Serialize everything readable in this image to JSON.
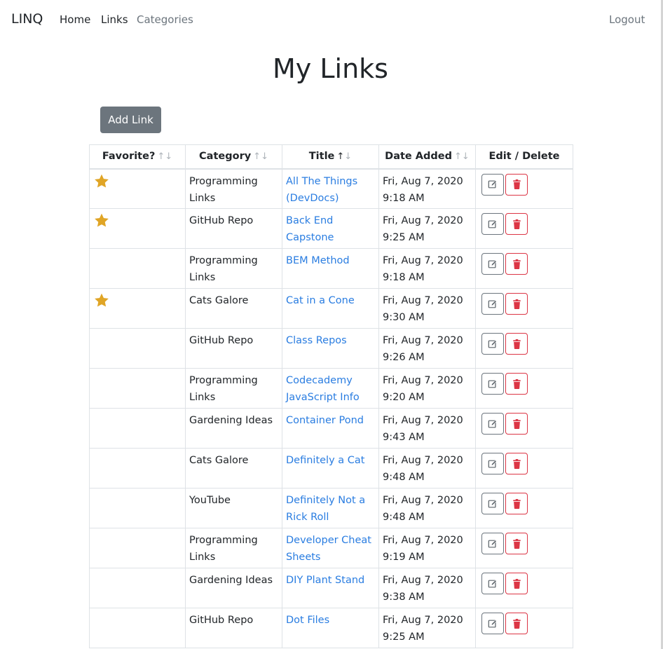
{
  "nav": {
    "brand": "LINQ",
    "home": "Home",
    "links": "Links",
    "categories": "Categories",
    "logout": "Logout"
  },
  "page": {
    "title": "My Links",
    "add_button": "Add Link"
  },
  "table": {
    "columns": [
      {
        "label": "Favorite?",
        "sort_icon": "↑↓"
      },
      {
        "label": "Category",
        "sort_icon": "↑↓"
      },
      {
        "label": "Title",
        "sort_icon_up": "↑",
        "sort_icon_down": "↓"
      },
      {
        "label": "Date Added",
        "sort_icon": "↑↓"
      },
      {
        "label": "Edit / Delete"
      }
    ],
    "rows": [
      {
        "favorite": true,
        "category": "Programming Links",
        "title": "All The Things (DevDocs)",
        "date": "Fri, Aug 7, 2020",
        "time": "9:18 AM"
      },
      {
        "favorite": true,
        "category": "GitHub Repo",
        "title": "Back End Capstone",
        "date": "Fri, Aug 7, 2020",
        "time": "9:25 AM"
      },
      {
        "favorite": false,
        "category": "Programming Links",
        "title": "BEM Method",
        "date": "Fri, Aug 7, 2020",
        "time": "9:18 AM"
      },
      {
        "favorite": true,
        "category": "Cats Galore",
        "title": "Cat in a Cone",
        "date": "Fri, Aug 7, 2020",
        "time": "9:30 AM"
      },
      {
        "favorite": false,
        "category": "GitHub Repo",
        "title": "Class Repos",
        "date": "Fri, Aug 7, 2020",
        "time": "9:26 AM"
      },
      {
        "favorite": false,
        "category": "Programming Links",
        "title": "Codecademy JavaScript Info",
        "date": "Fri, Aug 7, 2020",
        "time": "9:20 AM"
      },
      {
        "favorite": false,
        "category": "Gardening Ideas",
        "title": "Container Pond",
        "date": "Fri, Aug 7, 2020",
        "time": "9:43 AM"
      },
      {
        "favorite": false,
        "category": "Cats Galore",
        "title": "Definitely a Cat",
        "date": "Fri, Aug 7, 2020",
        "time": "9:48 AM"
      },
      {
        "favorite": false,
        "category": "YouTube",
        "title": "Definitely Not a Rick Roll",
        "date": "Fri, Aug 7, 2020",
        "time": "9:48 AM"
      },
      {
        "favorite": false,
        "category": "Programming Links",
        "title": "Developer Cheat Sheets",
        "date": "Fri, Aug 7, 2020",
        "time": "9:19 AM"
      },
      {
        "favorite": false,
        "category": "Gardening Ideas",
        "title": "DIY Plant Stand",
        "date": "Fri, Aug 7, 2020",
        "time": "9:38 AM"
      },
      {
        "favorite": false,
        "category": "GitHub Repo",
        "title": "Dot Files",
        "date": "Fri, Aug 7, 2020",
        "time": "9:25 AM"
      }
    ]
  },
  "icons": {
    "favorite": "star-icon",
    "edit": "edit-icon",
    "delete": "trash-icon"
  },
  "colors": {
    "star": "#e0a526",
    "link": "#2a7de1",
    "danger": "#dc3545",
    "secondary": "#6c757d"
  }
}
